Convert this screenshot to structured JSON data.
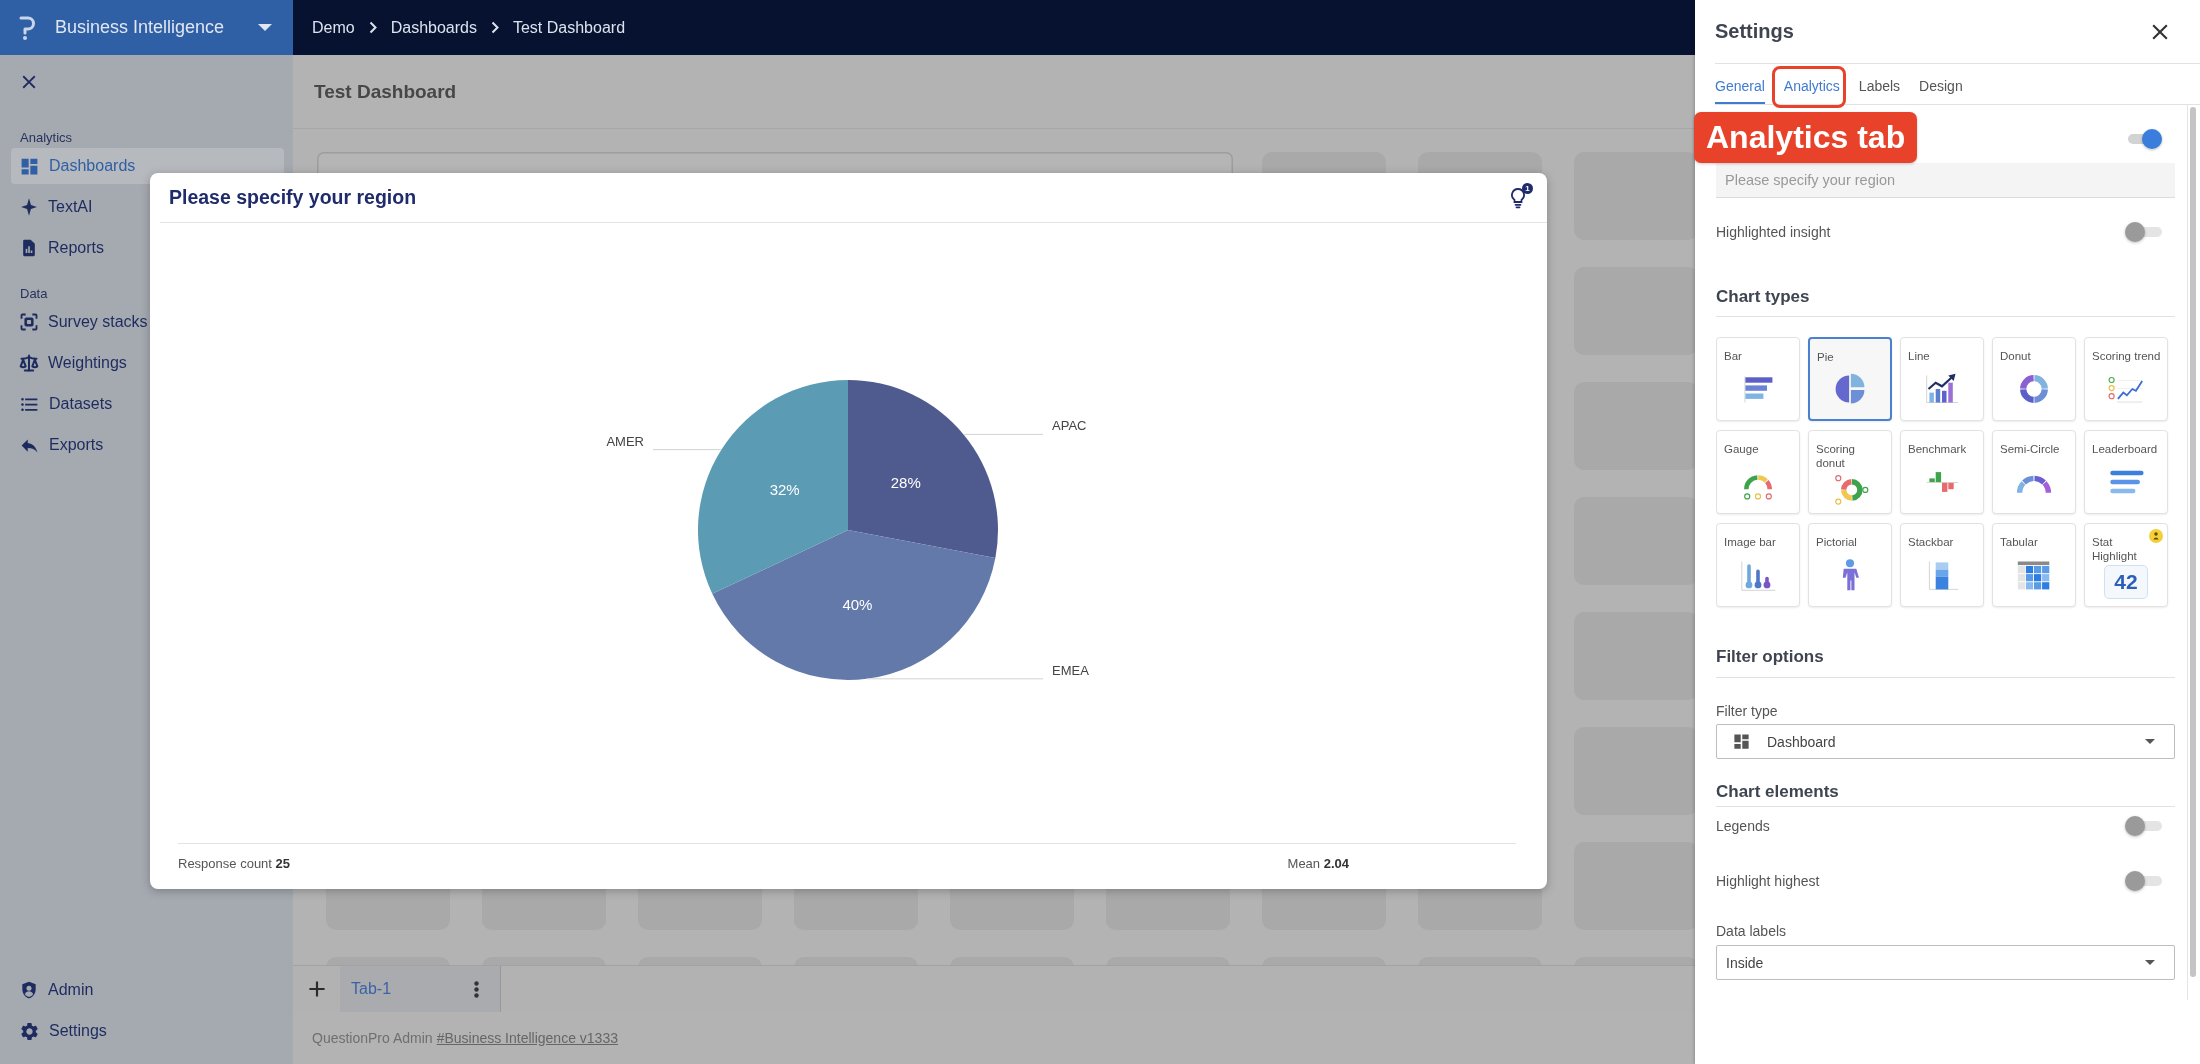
{
  "header": {
    "app_title": "Business Intelligence",
    "breadcrumb": [
      "Demo",
      "Dashboards",
      "Test Dashboard"
    ]
  },
  "sidebar": {
    "sections": [
      {
        "title": "Analytics",
        "items": [
          {
            "label": "Dashboards",
            "selected": true
          },
          {
            "label": "TextAI",
            "selected": false
          },
          {
            "label": "Reports",
            "selected": false
          }
        ]
      },
      {
        "title": "Data",
        "items": [
          {
            "label": "Survey stacks",
            "selected": false
          },
          {
            "label": "Weightings",
            "selected": false
          },
          {
            "label": "Datasets",
            "selected": false
          },
          {
            "label": "Exports",
            "selected": false
          }
        ]
      }
    ],
    "bottom_items": [
      {
        "label": "Admin",
        "selected": false
      },
      {
        "label": "Settings",
        "selected": false
      }
    ]
  },
  "dashboard": {
    "title": "Test Dashboard",
    "tabs": [
      {
        "label": "Tab-1",
        "selected": true
      }
    ],
    "footer": {
      "text": "QuestionPro Admin",
      "link": "#Business Intelligence v1333"
    }
  },
  "widget": {
    "title": "Please specify your region",
    "insight_count": "1",
    "chart_data": {
      "type": "pie",
      "categories": [
        "APAC",
        "EMEA",
        "AMER"
      ],
      "values": [
        28,
        40,
        32
      ],
      "value_labels": [
        "28%",
        "40%",
        "32%"
      ]
    },
    "stats": [
      "Response count **25**",
      "Mean **2.04**"
    ]
  },
  "settings": {
    "title": "Settings",
    "tabs": [
      {
        "label": "General",
        "selected": true,
        "hovered": false,
        "annotated": false
      },
      {
        "label": "Analytics",
        "selected": false,
        "hovered": true,
        "annotated": true
      },
      {
        "label": "Labels",
        "selected": false,
        "hovered": false,
        "annotated": false
      },
      {
        "label": "Design",
        "selected": false,
        "hovered": false,
        "annotated": false
      }
    ],
    "annotation": {
      "label": "Analytics tab"
    },
    "title_toggle": {
      "on": true
    },
    "title_field": {
      "placeholder": "Please specify your region"
    },
    "highlighted_insight": {
      "label": "Highlighted insight",
      "on": false
    },
    "chart_types": {
      "heading": "Chart types",
      "items": [
        {
          "label": "Bar",
          "kind": "bar",
          "selected": false,
          "badge": false
        },
        {
          "label": "Pie",
          "kind": "pie",
          "selected": true,
          "badge": false
        },
        {
          "label": "Line",
          "kind": "line",
          "selected": false,
          "badge": false
        },
        {
          "label": "Donut",
          "kind": "donut",
          "selected": false,
          "badge": false
        },
        {
          "label": "Scoring trend",
          "kind": "trend",
          "selected": false,
          "badge": false
        },
        {
          "label": "Gauge",
          "kind": "gauge",
          "selected": false,
          "badge": false
        },
        {
          "label": "Scoring donut",
          "kind": "scoring",
          "selected": false,
          "badge": false
        },
        {
          "label": "Benchmark",
          "kind": "benchmark",
          "selected": false,
          "badge": false
        },
        {
          "label": "Semi-Circle",
          "kind": "semicircle",
          "selected": false,
          "badge": false
        },
        {
          "label": "Leaderboard",
          "kind": "leaderboard",
          "selected": false,
          "badge": false
        },
        {
          "label": "Image bar",
          "kind": "imagebar",
          "selected": false,
          "badge": false
        },
        {
          "label": "Pictorial",
          "kind": "pictorial",
          "selected": false,
          "badge": false
        },
        {
          "label": "Stackbar",
          "kind": "stackbar",
          "selected": false,
          "badge": false
        },
        {
          "label": "Tabular",
          "kind": "tabular",
          "selected": false,
          "badge": false
        },
        {
          "label": "Stat Highlight",
          "kind": "stat",
          "value": "42",
          "selected": false,
          "badge": true
        }
      ]
    },
    "filter_options": {
      "heading": "Filter options",
      "filter_type": {
        "label": "Filter type",
        "value": "Dashboard"
      }
    },
    "chart_elements": {
      "heading": "Chart elements",
      "legends": {
        "label": "Legends",
        "on": false
      },
      "highlight_highest": {
        "label": "Highlight highest",
        "on": false
      },
      "data_labels": {
        "label": "Data labels",
        "value": "Inside"
      }
    }
  }
}
